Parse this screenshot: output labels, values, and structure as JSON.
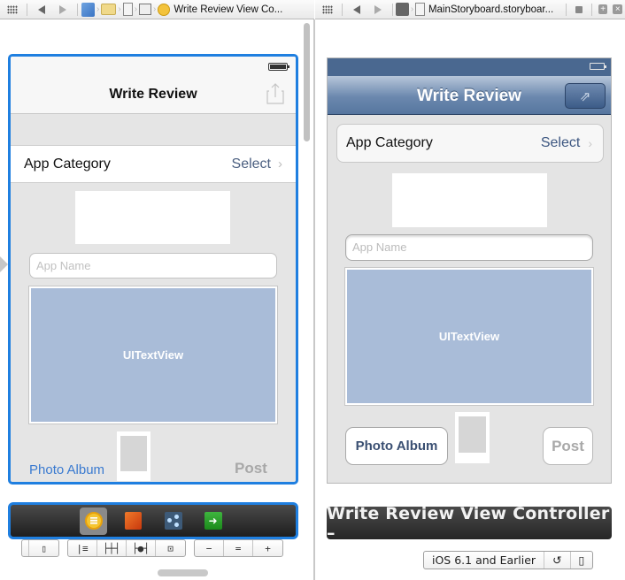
{
  "left_jumpbar": {
    "icons": [
      "related-items-icon",
      "back-icon",
      "forward-icon",
      "project-icon",
      "folder-icon",
      "file-icon",
      "storyboard-scene-icon",
      "view-controller-icon"
    ],
    "title": "Write Review View Co..."
  },
  "right_jumpbar": {
    "icons": [
      "related-items-icon",
      "back-icon",
      "forward-icon",
      "counterparts-icon",
      "storyboard-file-icon",
      "lock-icon",
      "add-editor-icon",
      "close-editor-icon"
    ],
    "title": "MainStoryboard.storyboar..."
  },
  "ios7_scene": {
    "nav_title": "Write Review",
    "cell_label": "App Category",
    "cell_value": "Select",
    "chevron": "›",
    "app_name_placeholder": "App Name",
    "text_view_label": "UITextView",
    "photo_button": "Photo Album",
    "post_button": "Post"
  },
  "scene_dock": {
    "items": [
      {
        "name": "view-controller",
        "selected": true
      },
      {
        "name": "first-responder",
        "selected": false
      },
      {
        "name": "object-graph",
        "selected": false
      },
      {
        "name": "exit",
        "selected": false
      }
    ]
  },
  "layout_bar": {
    "groups": [
      [
        {
          "name": "simulated-metrics",
          "glyph": "▯"
        }
      ],
      [
        {
          "name": "align",
          "glyph": "|≡"
        },
        {
          "name": "pin",
          "glyph": "├┼┤"
        },
        {
          "name": "resolve",
          "glyph": "├●┤"
        },
        {
          "name": "resizing",
          "glyph": "⊡"
        }
      ],
      [
        {
          "name": "zoom-out",
          "glyph": "−"
        },
        {
          "name": "zoom-actual",
          "glyph": "="
        },
        {
          "name": "zoom-in",
          "glyph": "+"
        }
      ]
    ]
  },
  "ios6_scene": {
    "nav_title": "Write Review",
    "share_glyph": "⇗",
    "cell_label": "App Category",
    "cell_value": "Select",
    "chevron": "›",
    "app_name_placeholder": "App Name",
    "text_view_label": "UITextView",
    "photo_button": "Photo Album",
    "post_button": "Post"
  },
  "scene_label": "Write Review View Controller –",
  "preview_bar": {
    "version": "iOS 6.1 and Earlier",
    "orientation_glyph": "↺",
    "device_glyph": "▯"
  },
  "colors": {
    "selection_blue": "#1f7fe0",
    "ios7_tint": "#3a7ad0",
    "ios6_nav": "#56769f",
    "text_view_fill": "#a9bcd8"
  }
}
